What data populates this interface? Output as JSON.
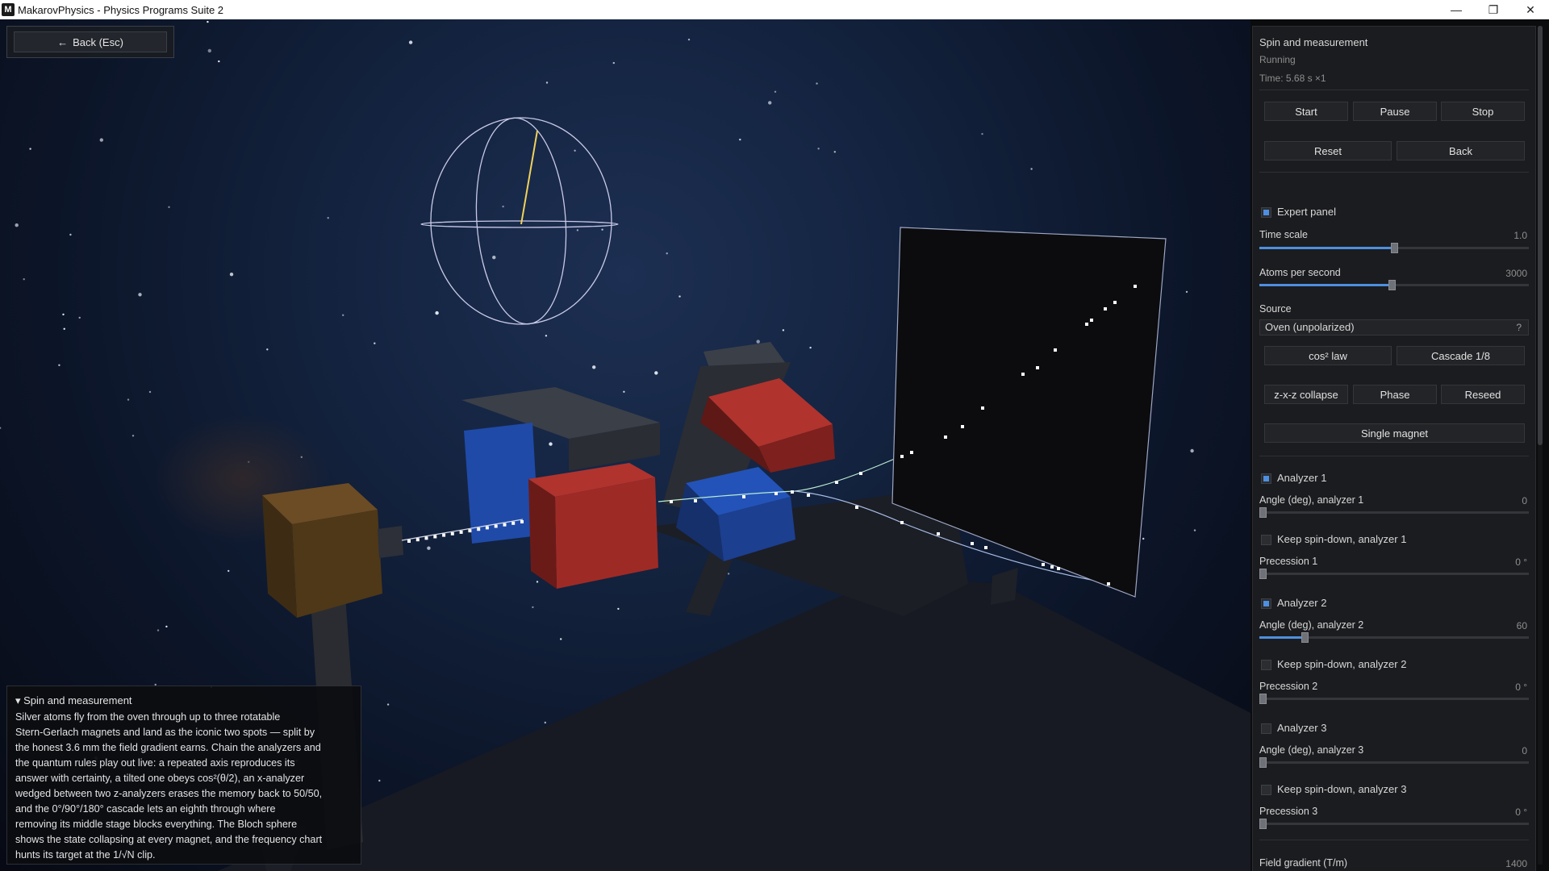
{
  "window": {
    "app_icon": "M",
    "title": "MakarovPhysics - Physics Programs Suite 2",
    "min_glyph": "—",
    "max_glyph": "❐",
    "close_glyph": "✕"
  },
  "viewport": {
    "back_button": {
      "arrow": "←",
      "label": "Back  (Esc)"
    },
    "info": {
      "title": "▾ Spin and measurement",
      "lines": [
        "Silver atoms fly from the oven through up to three rotatable",
        "Stern-Gerlach magnets and land as the iconic two spots — split by",
        "the honest 3.6 mm the field gradient earns. Chain the analyzers and",
        "the quantum rules play out live: a repeated axis reproduces its",
        "answer with certainty, a tilted one obeys cos²(θ/2), an x-analyzer",
        "wedged between two z-analyzers erases the memory back to 50/50,",
        "and the 0°/90°/180° cascade lets an eighth through where",
        "removing its middle stage blocks everything. The Bloch sphere",
        "shows the state collapsing at every magnet, and the frequency chart",
        "hunts its target at the 1/√N clip."
      ]
    }
  },
  "panel": {
    "title": "Spin and measurement",
    "status": "Running",
    "time": "Time: 5.68 s   ×1",
    "buttons": {
      "start": "Start",
      "pause": "Pause",
      "stop": "Stop",
      "reset": "Reset",
      "back": "Back",
      "cos2": "cos² law",
      "cascade": "Cascade 1/8",
      "zxz": "z-x-z collapse",
      "phase": "Phase",
      "reseed": "Reseed",
      "single": "Single magnet"
    },
    "expert_panel": {
      "label": "Expert panel",
      "checked": true
    },
    "time_scale": {
      "label": "Time scale",
      "value": "1.0",
      "fraction": 0.5
    },
    "atoms_per_second": {
      "label": "Atoms per second",
      "value": "3000",
      "fraction": 0.49
    },
    "source": {
      "label": "Source",
      "value": "Oven (unpolarized)",
      "hint": "?"
    },
    "analyzer1": {
      "label": "Analyzer 1",
      "checked": true,
      "angle_label": "Angle (deg), analyzer 1",
      "angle_value": "0",
      "angle_fraction": 0.0,
      "keep_label": "Keep spin-down, analyzer 1",
      "keep_checked": false,
      "prec_label": "Precession 1",
      "prec_value": "0 °",
      "prec_fraction": 0.0
    },
    "analyzer2": {
      "label": "Analyzer 2",
      "checked": true,
      "angle_label": "Angle (deg), analyzer 2",
      "angle_value": "60",
      "angle_fraction": 0.167,
      "keep_label": "Keep spin-down, analyzer 2",
      "keep_checked": false,
      "prec_label": "Precession 2",
      "prec_value": "0 °",
      "prec_fraction": 0.0
    },
    "analyzer3": {
      "label": "Analyzer 3",
      "checked": false,
      "angle_label": "Angle (deg), analyzer 3",
      "angle_value": "0",
      "angle_fraction": 0.0,
      "keep_label": "Keep spin-down, analyzer 3",
      "keep_checked": false,
      "prec_label": "Precession 3",
      "prec_value": "0 °",
      "prec_fraction": 0.0
    },
    "field_gradient": {
      "label": "Field gradient (T/m)",
      "value": "1400"
    }
  },
  "colors": {
    "accent": "#4d8fe0",
    "magnet_red": "#9e2a26",
    "magnet_blue": "#1f4aa8",
    "oven_brown": "#5e4320",
    "beam_up": "#b9ecd2",
    "beam_down": "#a9bde6",
    "bloch_arrow": "#f1d25a"
  }
}
